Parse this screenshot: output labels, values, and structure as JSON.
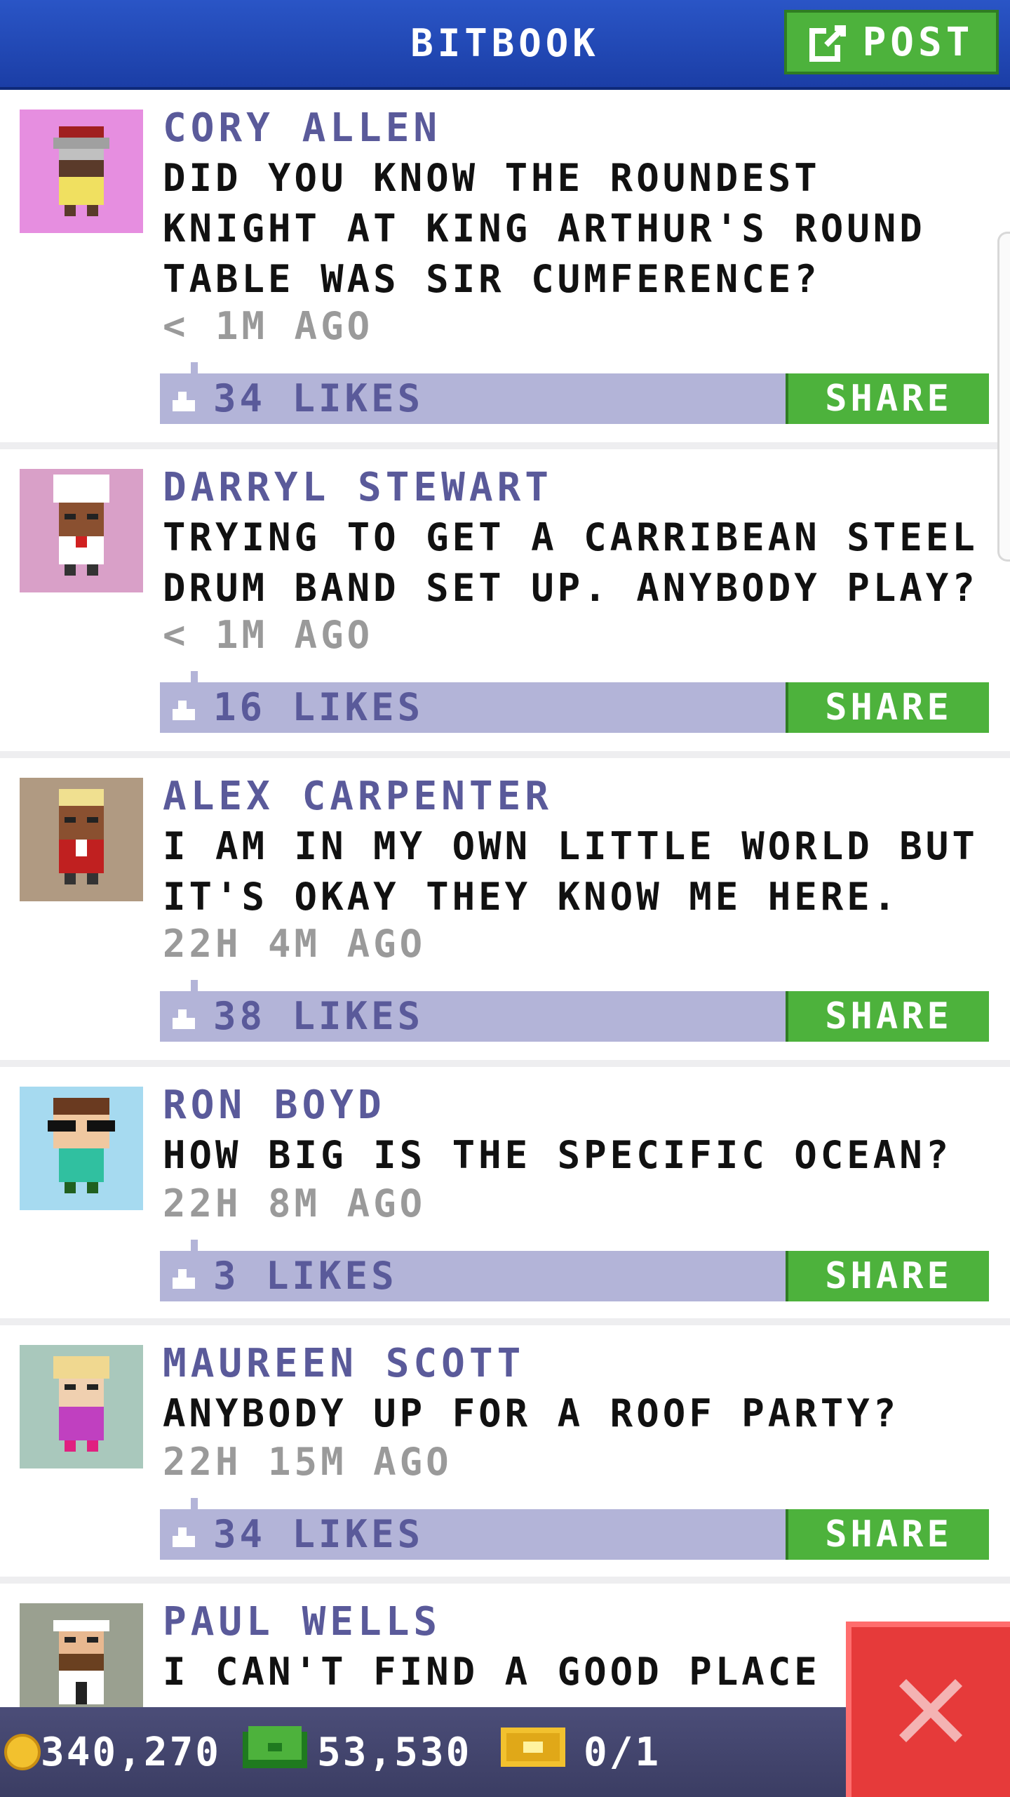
{
  "header": {
    "title": "BITBOOK",
    "post_label": "POST"
  },
  "posts": [
    {
      "name": "CORY ALLEN",
      "text": "DID YOU KNOW THE ROUNDEST KNIGHT AT KING ARTHUR'S ROUND TABLE WAS SIR CUMFERENCE?",
      "time": "< 1M AGO",
      "likes": "34 LIKES",
      "share": "SHARE",
      "avatar_bg": "#e68ee0"
    },
    {
      "name": "DARRYL STEWART",
      "text": "TRYING TO GET A CARRIBEAN STEEL DRUM BAND SET UP. ANYBODY PLAY?",
      "time": "< 1M AGO",
      "likes": "16 LIKES",
      "share": "SHARE",
      "avatar_bg": "#d9a0c8"
    },
    {
      "name": "ALEX CARPENTER",
      "text": "I AM IN MY OWN LITTLE WORLD BUT IT'S OKAY THEY KNOW ME HERE.",
      "time": "22H 4M AGO",
      "likes": "38 LIKES",
      "share": "SHARE",
      "avatar_bg": "#b09a82"
    },
    {
      "name": "RON BOYD",
      "text": "HOW BIG IS THE SPECIFIC OCEAN?",
      "time": "22H 8M AGO",
      "likes": "3 LIKES",
      "share": "SHARE",
      "avatar_bg": "#a6daf0"
    },
    {
      "name": "MAUREEN SCOTT",
      "text": "ANYBODY UP FOR A ROOF PARTY?",
      "time": "22H 15M AGO",
      "likes": "34 LIKES",
      "share": "SHARE",
      "avatar_bg": "#a9c8bc"
    },
    {
      "name": "PAUL WELLS",
      "text": "I CAN'T FIND A GOOD PLACE TO",
      "time": "",
      "likes": "",
      "share": "",
      "avatar_bg": "#9aa090"
    }
  ],
  "bottom": {
    "coins": "340,270",
    "bux": "53,530",
    "tickets": "0/1"
  },
  "colors": {
    "header": "#2a55c6",
    "accent_green": "#4db23c",
    "like_bar": "#b3b4d8",
    "close_red": "#e63a3a"
  }
}
